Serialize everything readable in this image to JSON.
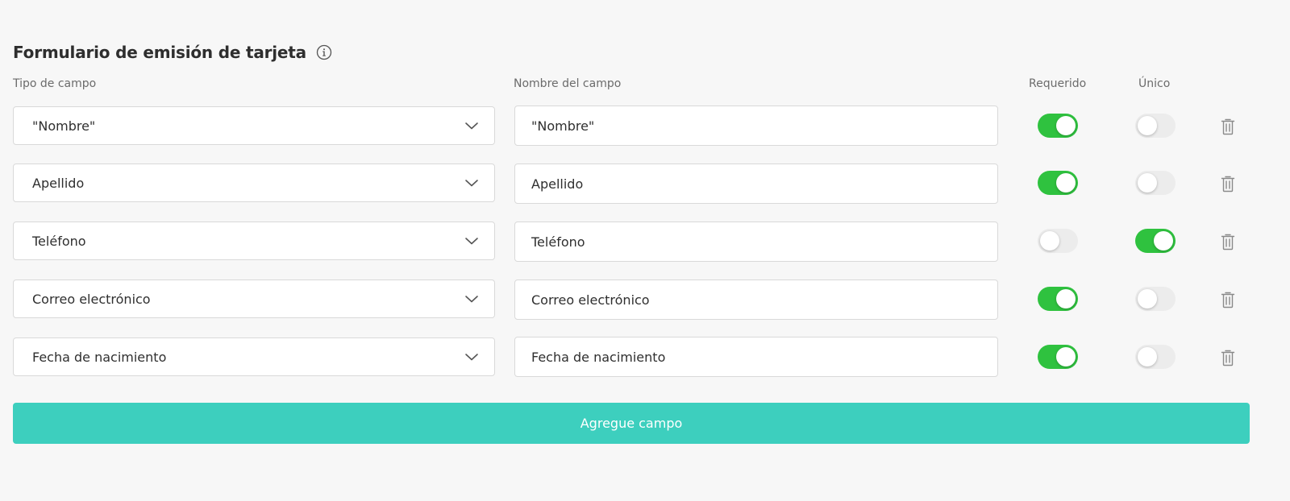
{
  "form": {
    "title": "Formulario de emisión de tarjeta",
    "info_icon": "info-icon"
  },
  "headers": {
    "field_type": "Tipo de campo",
    "field_name": "Nombre del campo",
    "required": "Requerido",
    "unique": "Único"
  },
  "rows": [
    {
      "type": "\"Nombre\"",
      "name": "\"Nombre\"",
      "required": true,
      "unique": false
    },
    {
      "type": "Apellido",
      "name": "Apellido",
      "required": true,
      "unique": false
    },
    {
      "type": "Teléfono",
      "name": "Teléfono",
      "required": false,
      "unique": true
    },
    {
      "type": "Correo electrónico",
      "name": "Correo electrónico",
      "required": true,
      "unique": false
    },
    {
      "type": "Fecha de nacimiento",
      "name": "Fecha de nacimiento",
      "required": true,
      "unique": false
    }
  ],
  "add_button": {
    "label": "Agregue campo"
  },
  "colors": {
    "background": "#f7f7f7",
    "toggle_on": "#2fc23f",
    "toggle_off": "#ececec",
    "add_button": "#3dcfbe"
  },
  "icons": {
    "chevron": "chevron-down-icon",
    "delete": "trash-icon"
  }
}
